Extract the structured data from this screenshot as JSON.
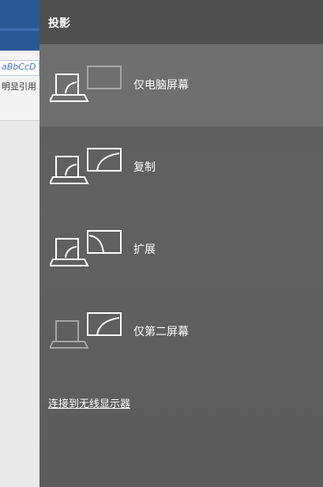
{
  "background_app": {
    "style_sample": "aBbCcD",
    "style_name": "明显引用"
  },
  "panel": {
    "title": "投影",
    "options": [
      {
        "label": "仅电脑屏幕",
        "icon": "pc-screen-only-icon",
        "selected": true
      },
      {
        "label": "复制",
        "icon": "duplicate-icon",
        "selected": false
      },
      {
        "label": "扩展",
        "icon": "extend-icon",
        "selected": false
      },
      {
        "label": "仅第二屏幕",
        "icon": "second-screen-only-icon",
        "selected": false
      }
    ],
    "wireless_link": "连接到无线显示器"
  },
  "colors": {
    "panel_bg": "#5c5c5c",
    "header_bg": "#4f4f4f",
    "selected_bg": "#6f6f6f",
    "icon_active": "#ffffff",
    "icon_inactive": "#a6a6a6"
  }
}
